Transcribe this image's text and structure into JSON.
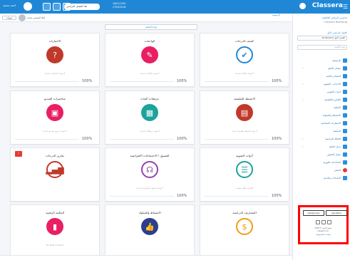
{
  "brand": {
    "name": "Classera"
  },
  "colors": {
    "primary": "#1f87d6",
    "teal": "#1ba39c",
    "red": "#c0392b",
    "pink": "#e91e63",
    "orange": "#f39c12",
    "purple": "#8e44ad",
    "navy": "#2c3e8f",
    "highlight": "#ff0000"
  },
  "header": {
    "user_name": "احمد محمد",
    "menu_icon": "hamburger-icon",
    "logo_icon": "classera-logo-icon",
    "semester_pill": "هذا الفصل الدراسي",
    "date_line1": "18/01/1440",
    "date_line2": "27/09/2018"
  },
  "subbar": {
    "greeting": "اهلا الرئيسي محمد",
    "notif_label": "تنبيهات",
    "breadcrumb": "الرئيسية"
  },
  "sidebar": {
    "school_name": "مدارس الرياض العالمية",
    "school_sub": "Classera Boarding",
    "semester_label": "الفصل الدراسي الاول",
    "semester_value": "الفصل الاول 2018/2019",
    "search_placeholder": "بحث بالاسم",
    "items": [
      {
        "label": "الرئيسية",
        "icon": "home-icon",
        "chev": false
      },
      {
        "label": "مصادر التعلم",
        "icon": "book-icon",
        "chev": true
      },
      {
        "label": "المصادر العامة",
        "icon": "folder-icon",
        "chev": false
      },
      {
        "label": "الاحداث - التقويم",
        "icon": "calendar-icon",
        "chev": true
      },
      {
        "label": "ادوات التقويم",
        "icon": "tools-icon",
        "chev": false
      },
      {
        "label": "التقارير التعليمية",
        "icon": "report-icon",
        "chev": true
      },
      {
        "label": "المكتبة",
        "icon": "library-icon",
        "chev": false
      },
      {
        "label": "الانضباط والسلوك",
        "icon": "behavior-icon",
        "chev": false
      },
      {
        "label": "الاشعارات الجماعية",
        "icon": "bell-icon",
        "chev": false
      },
      {
        "label": "المتابعة",
        "icon": "follow-icon",
        "chev": false
      },
      {
        "label": "الخطة الدراسية",
        "icon": "plan-icon",
        "chev": true
      },
      {
        "label": "مركز التعلم",
        "icon": "center-icon",
        "chev": true
      },
      {
        "label": "سجل الحضور",
        "icon": "attendance-icon",
        "chev": false
      },
      {
        "label": "المحادثات الفورية",
        "icon": "chat-icon",
        "chev": false
      },
      {
        "label": "المتجر",
        "icon": "store-icon",
        "chev": false,
        "red": true
      },
      {
        "label": "الاعدادات والدعم",
        "icon": "settings-icon",
        "chev": false
      }
    ],
    "store": {
      "google_play": "Google play",
      "app_store": "App Store",
      "copyright": "حقوق النشر © 2018",
      "company": "Classera Inc.",
      "link": "سياسة الخصوصية"
    }
  },
  "main": {
    "top_button": "لوحة التحكم",
    "cards": [
      {
        "title": "كشف الدرجات",
        "sub": "لا يوجد ملفات جديدة",
        "pct": "100%",
        "icon": "check-circle-icon",
        "glyph": "✔",
        "color": "#1f87d6",
        "ring": true
      },
      {
        "title": "الواجبات",
        "sub": "لا يوجد واجبات جديدة",
        "pct": "100%",
        "icon": "pencil-icon",
        "glyph": "✎",
        "color": "#e91e63",
        "ring": false
      },
      {
        "title": "الاختبارات",
        "sub": "لا يوجد اختبارات جديدة",
        "pct": "100%",
        "icon": "question-icon",
        "glyph": "?",
        "color": "#c0392b",
        "ring": false
      },
      {
        "title": "الانشطة التعليمية",
        "sub": "لا يوجد انشطة تعليمية جديدة",
        "pct": "100%",
        "icon": "book-open-icon",
        "glyph": "▤",
        "color": "#c0392b",
        "ring": false
      },
      {
        "title": "مرفقات المادة",
        "sub": "لا يوجد مرفقات جديدة",
        "pct": "100%",
        "icon": "attachment-icon",
        "glyph": "▦",
        "color": "#1ba39c",
        "ring": false
      },
      {
        "title": "محاضرات الفيديو",
        "sub": "لا توجد دروس فيديو جديدة",
        "pct": "100%",
        "icon": "film-icon",
        "glyph": "▣",
        "color": "#e91e63",
        "ring": false
      },
      {
        "title": "أدوات التقويم",
        "sub": "الادوات الغير مقيمة",
        "pct": "100%",
        "icon": "list-icon",
        "glyph": "☰",
        "color": "#1ba39c",
        "ring": true
      },
      {
        "title": "الفصول / الاجتماعات الافتراضية",
        "sub": "لا يوجد فصول افتراضية جديدة",
        "pct": "100%",
        "icon": "headphones-icon",
        "glyph": "☊",
        "color": "#8e44ad",
        "ring": true
      },
      {
        "title": "تقارير الدرجات",
        "sub": "",
        "pct": "",
        "icon": "bar-chart-icon",
        "glyph": "▂▄▆",
        "color": "#c0392b",
        "ring": true,
        "badge": "!"
      },
      {
        "title": "المصاريف الدراسية",
        "sub": "",
        "pct": "",
        "icon": "dollar-icon",
        "glyph": "$",
        "color": "#f39c12",
        "ring": true
      },
      {
        "title": "الانضباط والسلوك",
        "sub": "",
        "pct": "",
        "icon": "thumbs-up-icon",
        "glyph": "👍",
        "color": "#2c3e8f",
        "ring": false
      },
      {
        "title": "المكتبة الرقمية",
        "sub": "No New Content",
        "pct": "",
        "icon": "book-icon",
        "glyph": "▮",
        "color": "#e91e63",
        "ring": false
      }
    ]
  }
}
